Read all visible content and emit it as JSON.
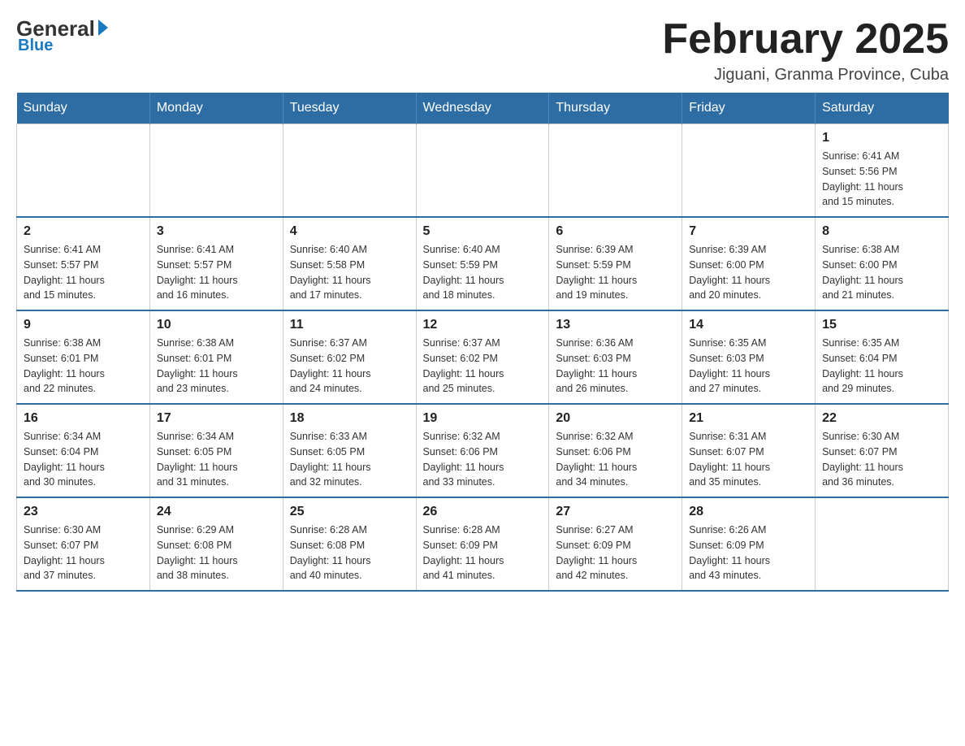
{
  "logo": {
    "general": "General",
    "blue": "Blue"
  },
  "title": "February 2025",
  "subtitle": "Jiguani, Granma Province, Cuba",
  "weekdays": [
    "Sunday",
    "Monday",
    "Tuesday",
    "Wednesday",
    "Thursday",
    "Friday",
    "Saturday"
  ],
  "weeks": [
    [
      {
        "day": "",
        "info": ""
      },
      {
        "day": "",
        "info": ""
      },
      {
        "day": "",
        "info": ""
      },
      {
        "day": "",
        "info": ""
      },
      {
        "day": "",
        "info": ""
      },
      {
        "day": "",
        "info": ""
      },
      {
        "day": "1",
        "info": "Sunrise: 6:41 AM\nSunset: 5:56 PM\nDaylight: 11 hours\nand 15 minutes."
      }
    ],
    [
      {
        "day": "2",
        "info": "Sunrise: 6:41 AM\nSunset: 5:57 PM\nDaylight: 11 hours\nand 15 minutes."
      },
      {
        "day": "3",
        "info": "Sunrise: 6:41 AM\nSunset: 5:57 PM\nDaylight: 11 hours\nand 16 minutes."
      },
      {
        "day": "4",
        "info": "Sunrise: 6:40 AM\nSunset: 5:58 PM\nDaylight: 11 hours\nand 17 minutes."
      },
      {
        "day": "5",
        "info": "Sunrise: 6:40 AM\nSunset: 5:59 PM\nDaylight: 11 hours\nand 18 minutes."
      },
      {
        "day": "6",
        "info": "Sunrise: 6:39 AM\nSunset: 5:59 PM\nDaylight: 11 hours\nand 19 minutes."
      },
      {
        "day": "7",
        "info": "Sunrise: 6:39 AM\nSunset: 6:00 PM\nDaylight: 11 hours\nand 20 minutes."
      },
      {
        "day": "8",
        "info": "Sunrise: 6:38 AM\nSunset: 6:00 PM\nDaylight: 11 hours\nand 21 minutes."
      }
    ],
    [
      {
        "day": "9",
        "info": "Sunrise: 6:38 AM\nSunset: 6:01 PM\nDaylight: 11 hours\nand 22 minutes."
      },
      {
        "day": "10",
        "info": "Sunrise: 6:38 AM\nSunset: 6:01 PM\nDaylight: 11 hours\nand 23 minutes."
      },
      {
        "day": "11",
        "info": "Sunrise: 6:37 AM\nSunset: 6:02 PM\nDaylight: 11 hours\nand 24 minutes."
      },
      {
        "day": "12",
        "info": "Sunrise: 6:37 AM\nSunset: 6:02 PM\nDaylight: 11 hours\nand 25 minutes."
      },
      {
        "day": "13",
        "info": "Sunrise: 6:36 AM\nSunset: 6:03 PM\nDaylight: 11 hours\nand 26 minutes."
      },
      {
        "day": "14",
        "info": "Sunrise: 6:35 AM\nSunset: 6:03 PM\nDaylight: 11 hours\nand 27 minutes."
      },
      {
        "day": "15",
        "info": "Sunrise: 6:35 AM\nSunset: 6:04 PM\nDaylight: 11 hours\nand 29 minutes."
      }
    ],
    [
      {
        "day": "16",
        "info": "Sunrise: 6:34 AM\nSunset: 6:04 PM\nDaylight: 11 hours\nand 30 minutes."
      },
      {
        "day": "17",
        "info": "Sunrise: 6:34 AM\nSunset: 6:05 PM\nDaylight: 11 hours\nand 31 minutes."
      },
      {
        "day": "18",
        "info": "Sunrise: 6:33 AM\nSunset: 6:05 PM\nDaylight: 11 hours\nand 32 minutes."
      },
      {
        "day": "19",
        "info": "Sunrise: 6:32 AM\nSunset: 6:06 PM\nDaylight: 11 hours\nand 33 minutes."
      },
      {
        "day": "20",
        "info": "Sunrise: 6:32 AM\nSunset: 6:06 PM\nDaylight: 11 hours\nand 34 minutes."
      },
      {
        "day": "21",
        "info": "Sunrise: 6:31 AM\nSunset: 6:07 PM\nDaylight: 11 hours\nand 35 minutes."
      },
      {
        "day": "22",
        "info": "Sunrise: 6:30 AM\nSunset: 6:07 PM\nDaylight: 11 hours\nand 36 minutes."
      }
    ],
    [
      {
        "day": "23",
        "info": "Sunrise: 6:30 AM\nSunset: 6:07 PM\nDaylight: 11 hours\nand 37 minutes."
      },
      {
        "day": "24",
        "info": "Sunrise: 6:29 AM\nSunset: 6:08 PM\nDaylight: 11 hours\nand 38 minutes."
      },
      {
        "day": "25",
        "info": "Sunrise: 6:28 AM\nSunset: 6:08 PM\nDaylight: 11 hours\nand 40 minutes."
      },
      {
        "day": "26",
        "info": "Sunrise: 6:28 AM\nSunset: 6:09 PM\nDaylight: 11 hours\nand 41 minutes."
      },
      {
        "day": "27",
        "info": "Sunrise: 6:27 AM\nSunset: 6:09 PM\nDaylight: 11 hours\nand 42 minutes."
      },
      {
        "day": "28",
        "info": "Sunrise: 6:26 AM\nSunset: 6:09 PM\nDaylight: 11 hours\nand 43 minutes."
      },
      {
        "day": "",
        "info": ""
      }
    ]
  ],
  "colors": {
    "header_bg": "#2e6da4",
    "header_text": "#ffffff",
    "border": "#cccccc"
  }
}
